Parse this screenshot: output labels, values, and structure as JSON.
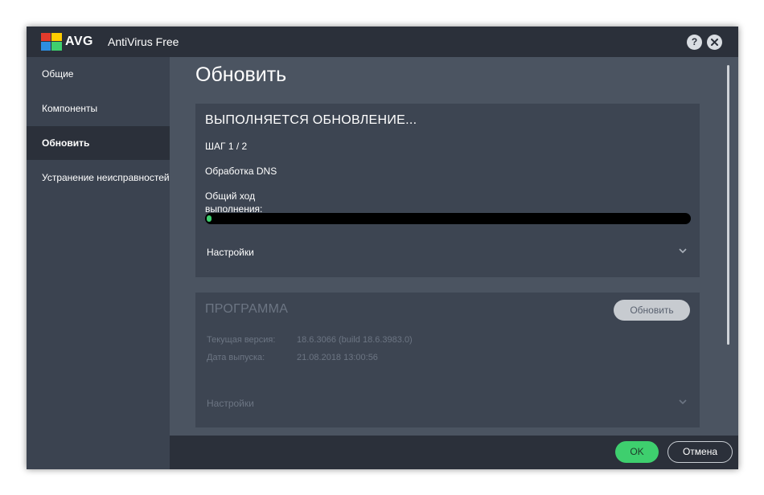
{
  "window": {
    "logo_text": "AVG",
    "app_name": "AntiVirus Free",
    "help_label": "?"
  },
  "sidebar": {
    "items": [
      {
        "label": "Общие"
      },
      {
        "label": "Компоненты"
      },
      {
        "label": "Обновить",
        "active": true
      },
      {
        "label": "Устранение неисправностей"
      }
    ]
  },
  "main": {
    "title": "Обновить",
    "update_panel": {
      "heading": "ВЫПОЛНЯЕТСЯ ОБНОВЛЕНИЕ...",
      "step": "ШАГ 1 / 2",
      "task": "Обработка DNS",
      "progress_label": "Общий ход выполнения:",
      "progress_fraction": 0.01,
      "settings_label": "Настройки"
    },
    "program_panel": {
      "heading": "ПРОГРАММА",
      "update_button": "Обновить",
      "version_label": "Текущая версия:",
      "version_value": "18.6.3066 (build 18.6.3983.0)",
      "date_label": "Дата выпуска:",
      "date_value": "21.08.2018 13:00:56",
      "settings_label": "Настройки"
    }
  },
  "footer": {
    "ok_label": "OK",
    "cancel_label": "Отмена"
  },
  "colors": {
    "accent_green": "#3ecf6e",
    "sidebar_bg": "#3b4350",
    "active_bg": "#2b303a",
    "panel_bg": "#3d4552"
  }
}
